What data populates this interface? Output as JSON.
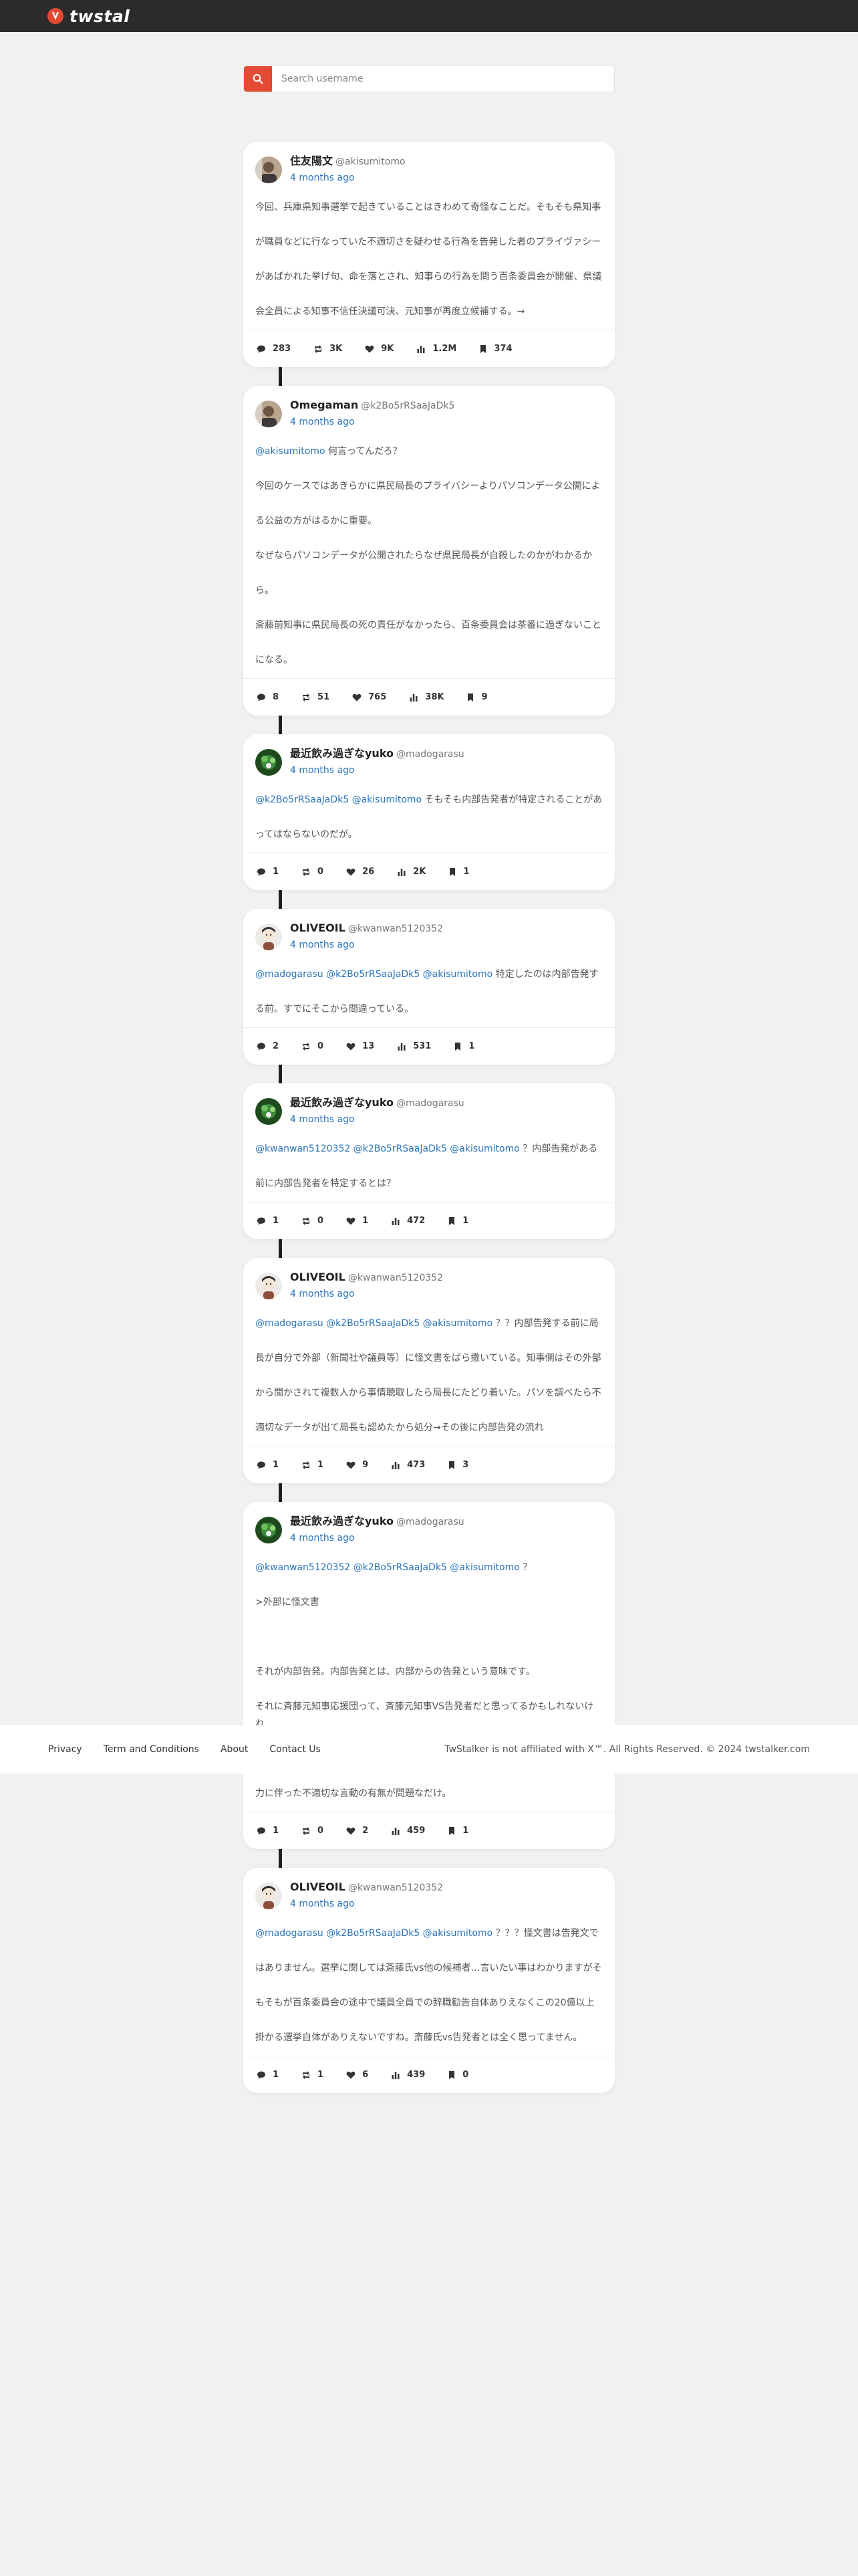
{
  "header": {
    "logo_text": "twstal",
    "brand_color": "#e24a34"
  },
  "search": {
    "placeholder": "Search username",
    "value": ""
  },
  "posts": [
    {
      "name": "住友陽文",
      "handle": "@akisumitomo",
      "time": "4 months ago",
      "avatar_icon": "user-avatar-photo",
      "body_lines": [
        "今回、兵庫県知事選挙で起きていることはきわめて奇怪なことだ。そもそも県知事",
        "が職員などに行なっていた不適切さを疑わせる行為を告発した者のプライヴァシー",
        "があばかれた挙げ句、命を落とされ、知事らの行為を問う百条委員会が開催、県議",
        "会全員による知事不信任決議可決、元知事が再度立候補する。→"
      ],
      "stats": {
        "replies": "283",
        "retweets": "3K",
        "likes": "9K",
        "views": "1.2M",
        "bookmarks": "374"
      }
    },
    {
      "name": "Omegaman",
      "handle": "@k2Bo5rRSaaJaDk5",
      "time": "4 months ago",
      "avatar_icon": "user-avatar-photo",
      "mentions": "@akisumitomo",
      "body_lines": [
        " 何言ってんだろ？",
        "今回のケースではあきらかに県民局長のプライバシーよりパソコンデータ公開によ",
        "る公益の方がはるかに重要。",
        "なぜならパソコンデータが公開されたらなぜ県民局長が自殺したのかがわかるか",
        "ら。",
        "斎藤前知事に県民局長の死の責任がなかったら、百条委員会は茶番に過ぎないこと",
        "になる。"
      ],
      "stats": {
        "replies": "8",
        "retweets": "51",
        "likes": "765",
        "views": "38K",
        "bookmarks": "9"
      }
    },
    {
      "name": "最近飲み過ぎなyuko",
      "handle": "@madogarasu",
      "time": "4 months ago",
      "avatar_icon": "user-avatar-plant",
      "mentions": "@k2Bo5rRSaaJaDk5 @akisumitomo",
      "body_lines": [
        " そもそも内部告発者が特定されることがあ",
        "ってはならないのだが。"
      ],
      "stats": {
        "replies": "1",
        "retweets": "0",
        "likes": "26",
        "views": "2K",
        "bookmarks": "1"
      }
    },
    {
      "name": "OLIVEOIL",
      "handle": "@kwanwan5120352",
      "time": "4 months ago",
      "avatar_icon": "user-avatar-illustration",
      "mentions": "@madogarasu @k2Bo5rRSaaJaDk5 @akisumitomo",
      "body_lines": [
        " 特定したのは内部告発す",
        "る前。すでにそこから間違っている。"
      ],
      "stats": {
        "replies": "2",
        "retweets": "0",
        "likes": "13",
        "views": "531",
        "bookmarks": "1"
      }
    },
    {
      "name": "最近飲み過ぎなyuko",
      "handle": "@madogarasu",
      "time": "4 months ago",
      "avatar_icon": "user-avatar-plant",
      "mentions": "@kwanwan5120352 @k2Bo5rRSaaJaDk5 @akisumitomo",
      "body_lines": [
        " ？内部告発がある",
        "前に内部告発者を特定するとは？"
      ],
      "stats": {
        "replies": "1",
        "retweets": "0",
        "likes": "1",
        "views": "472",
        "bookmarks": "1"
      }
    },
    {
      "name": "OLIVEOIL",
      "handle": "@kwanwan5120352",
      "time": "4 months ago",
      "avatar_icon": "user-avatar-illustration",
      "mentions": "@madogarasu @k2Bo5rRSaaJaDk5 @akisumitomo",
      "body_lines": [
        " ？？内部告発する前に局",
        "長が自分で外部（新聞社や議員等）に怪文書をばら撒いている。知事側はその外部",
        "から聞かされて複数人から事情聴取したら局長にたどり着いた。パソを調べたら不",
        "適切なデータが出て局長も認めたから処分→その後に内部告発の流れ"
      ],
      "stats": {
        "replies": "1",
        "retweets": "1",
        "likes": "9",
        "views": "473",
        "bookmarks": "3"
      }
    },
    {
      "name": "最近飲み過ぎなyuko",
      "handle": "@madogarasu",
      "time": "4 months ago",
      "avatar_icon": "user-avatar-plant",
      "mentions": "@kwanwan5120352 @k2Bo5rRSaaJaDk5 @akisumitomo",
      "body_lines": [
        " ？",
        ">外部に怪文書",
        "",
        "それが内部告発。内部告発とは、内部からの告発という意味です。",
        "それに斉藤元知事応援団って、斉藤元知事VS告発者だと思ってるかもしれないけれ",
        "ど、選挙は斉藤元知事VS他の候補者ですよ。パワハラ等は斉藤元知事が知事の権",
        "力に伴った不適切な言動の有無が問題なだけ。"
      ],
      "stats": {
        "replies": "1",
        "retweets": "0",
        "likes": "2",
        "views": "459",
        "bookmarks": "1"
      }
    },
    {
      "name": "OLIVEOIL",
      "handle": "@kwanwan5120352",
      "time": "4 months ago",
      "avatar_icon": "user-avatar-illustration",
      "mentions": "@madogarasu @k2Bo5rRSaaJaDk5 @akisumitomo",
      "body_lines": [
        " ？？？怪文書は告発文で",
        "はありません。選挙に関しては斎藤氏vs他の候補者…言いたい事はわかりますがそ",
        "もそもが百条委員会の途中で議員全員での辞職勧告自体ありえなくこの20億以上",
        "掛かる選挙自体がありえないですね。斎藤氏vs告発者とは全く思ってません。"
      ],
      "stats": {
        "replies": "1",
        "retweets": "1",
        "likes": "6",
        "views": "439",
        "bookmarks": "0"
      }
    }
  ],
  "footer": {
    "links": [
      "Privacy",
      "Term and Conditions",
      "About",
      "Contact Us"
    ],
    "copyright": "TwStalker is not affiliated with X™. All Rights Reserved. © 2024 twstalker.com"
  }
}
